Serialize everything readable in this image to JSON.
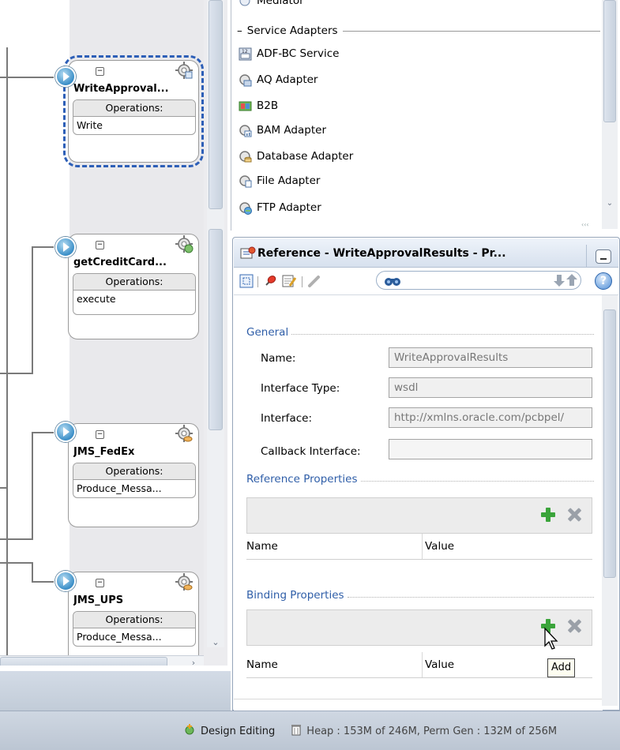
{
  "composite": {
    "references": [
      {
        "title": "WriteApproval...",
        "ops_header": "Operations:",
        "operation": "Write",
        "selected": true
      },
      {
        "title": "getCreditCard...",
        "ops_header": "Operations:",
        "operation": "execute",
        "selected": false
      },
      {
        "title": "JMS_FedEx",
        "ops_header": "Operations:",
        "operation": "Produce_Messa...",
        "selected": false
      },
      {
        "title": "JMS_UPS",
        "ops_header": "Operations:",
        "operation": "Produce_Messa...",
        "selected": false
      }
    ]
  },
  "palette": {
    "top_item": "Mediator",
    "section": "Service Adapters",
    "items": [
      {
        "label": "ADF-BC Service",
        "icon": "adf-bc-service-icon"
      },
      {
        "label": "AQ Adapter",
        "icon": "aq-adapter-icon"
      },
      {
        "label": "B2B",
        "icon": "b2b-icon"
      },
      {
        "label": "BAM Adapter",
        "icon": "bam-adapter-icon"
      },
      {
        "label": "Database Adapter",
        "icon": "database-adapter-icon"
      },
      {
        "label": "File Adapter",
        "icon": "file-adapter-icon"
      },
      {
        "label": "FTP Adapter",
        "icon": "ftp-adapter-icon"
      }
    ]
  },
  "inspector": {
    "title": "Reference - WriteApprovalResults - Pr...",
    "help": "?",
    "general": {
      "heading": "General",
      "name_label": "Name:",
      "name_value": "WriteApprovalResults",
      "interface_type_label": "Interface Type:",
      "interface_type_value": "wsdl",
      "interface_label": "Interface:",
      "interface_value": "http://xmlns.oracle.com/pcbpel/",
      "callback_label": "Callback Interface:",
      "callback_value": ""
    },
    "reference_properties": {
      "heading": "Reference Properties",
      "col_name": "Name",
      "col_value": "Value"
    },
    "binding_properties": {
      "heading": "Binding Properties",
      "col_name": "Name",
      "col_value": "Value"
    },
    "tooltip": "Add"
  },
  "statusbar": {
    "mode": "Design Editing",
    "memory": "Heap : 153M of 246M, Perm Gen : 132M of 256M"
  },
  "colors": {
    "accent": "#2f5ea8",
    "selection_dash": "#2d5fb7",
    "add_green": "#3aa43a",
    "statusbar": "#c6cfdb"
  }
}
